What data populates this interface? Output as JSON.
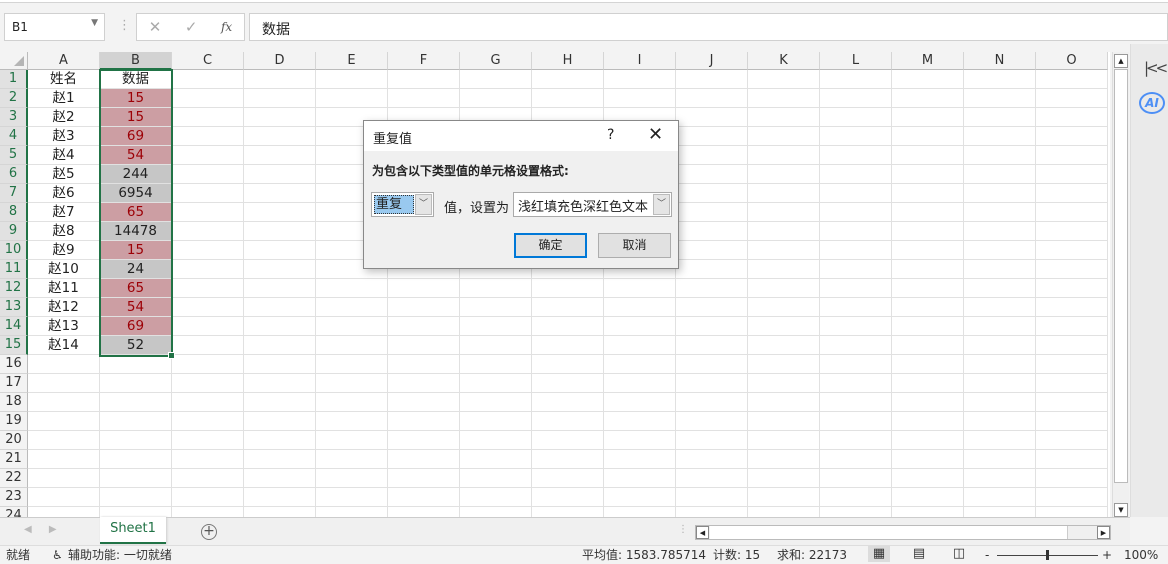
{
  "formula_bar": {
    "name_box": "B1",
    "formula": "数据",
    "cancel_icon": "✕",
    "enter_icon": "✓",
    "fx_label": "fx"
  },
  "columns": [
    "A",
    "B",
    "C",
    "D",
    "E",
    "F",
    "G",
    "H",
    "I",
    "J",
    "K",
    "L",
    "M",
    "N",
    "O"
  ],
  "rows_visible": 24,
  "header_row": {
    "a": "姓名",
    "b": "数据"
  },
  "data": [
    {
      "name": "赵1",
      "value": "15",
      "dup": true
    },
    {
      "name": "赵2",
      "value": "15",
      "dup": true
    },
    {
      "name": "赵3",
      "value": "69",
      "dup": true
    },
    {
      "name": "赵4",
      "value": "54",
      "dup": true
    },
    {
      "name": "赵5",
      "value": "244",
      "dup": false
    },
    {
      "name": "赵6",
      "value": "6954",
      "dup": false
    },
    {
      "name": "赵7",
      "value": "65",
      "dup": true
    },
    {
      "name": "赵8",
      "value": "14478",
      "dup": false
    },
    {
      "name": "赵9",
      "value": "15",
      "dup": true
    },
    {
      "name": "赵10",
      "value": "24",
      "dup": false
    },
    {
      "name": "赵11",
      "value": "65",
      "dup": true
    },
    {
      "name": "赵12",
      "value": "54",
      "dup": true
    },
    {
      "name": "赵13",
      "value": "69",
      "dup": true
    },
    {
      "name": "赵14",
      "value": "52",
      "dup": false
    }
  ],
  "colors": {
    "dup_fill": "#cc9ea3",
    "dup_text": "#9c0006",
    "selection": "#217346"
  },
  "dialog": {
    "title": "重复值",
    "help": "?",
    "close": "✕",
    "prompt": "为包含以下类型值的单元格设置格式:",
    "type_value": "重复",
    "middle_label": "值，设置为",
    "format_value": "浅红填充色深红色文本",
    "ok": "确定",
    "cancel": "取消"
  },
  "sheet_tabs": {
    "active": "Sheet1",
    "add": "+"
  },
  "side_panel": {
    "ai_label": "AI"
  },
  "status": {
    "ready": "就绪",
    "accessibility": "辅助功能: 一切就绪",
    "average": "平均值: 1583.785714",
    "count": "计数: 15",
    "sum": "求和: 22173",
    "zoom": "100%",
    "zoom_minus": "-",
    "zoom_plus": "+"
  }
}
